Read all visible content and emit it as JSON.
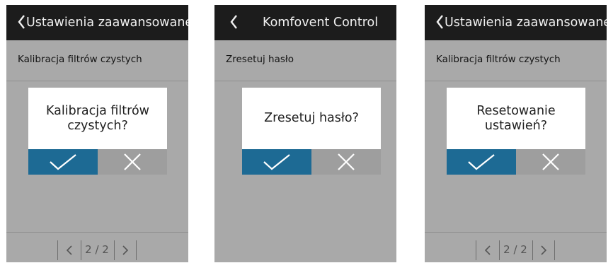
{
  "colors": {
    "header": "#1c1c1c",
    "screen": "#a9a9a9",
    "confirm": "#1d6a94",
    "cancel": "#9e9e9e",
    "dialog": "#ffffff"
  },
  "icons": {
    "back": "chevron-left-icon",
    "confirm": "check-icon",
    "cancel": "close-icon",
    "page_prev": "chevron-left-icon",
    "page_next": "chevron-right-icon"
  },
  "screens": [
    {
      "title": "Ustawienia zaawansowane",
      "row_label": "Kalibracja filtrów czystych",
      "dialog_text": "Kalibracja filtrów\nczystych?",
      "pager": "2 / 2"
    },
    {
      "title": "Komfovent Control",
      "row_label": "Zresetuj hasło",
      "dialog_text": "Zresetuj hasło?"
    },
    {
      "title": "Ustawienia zaawansowane",
      "row_label": "Kalibracja filtrów czystych",
      "dialog_text": "Resetowanie\nustawień?",
      "pager": "2 / 2"
    }
  ]
}
